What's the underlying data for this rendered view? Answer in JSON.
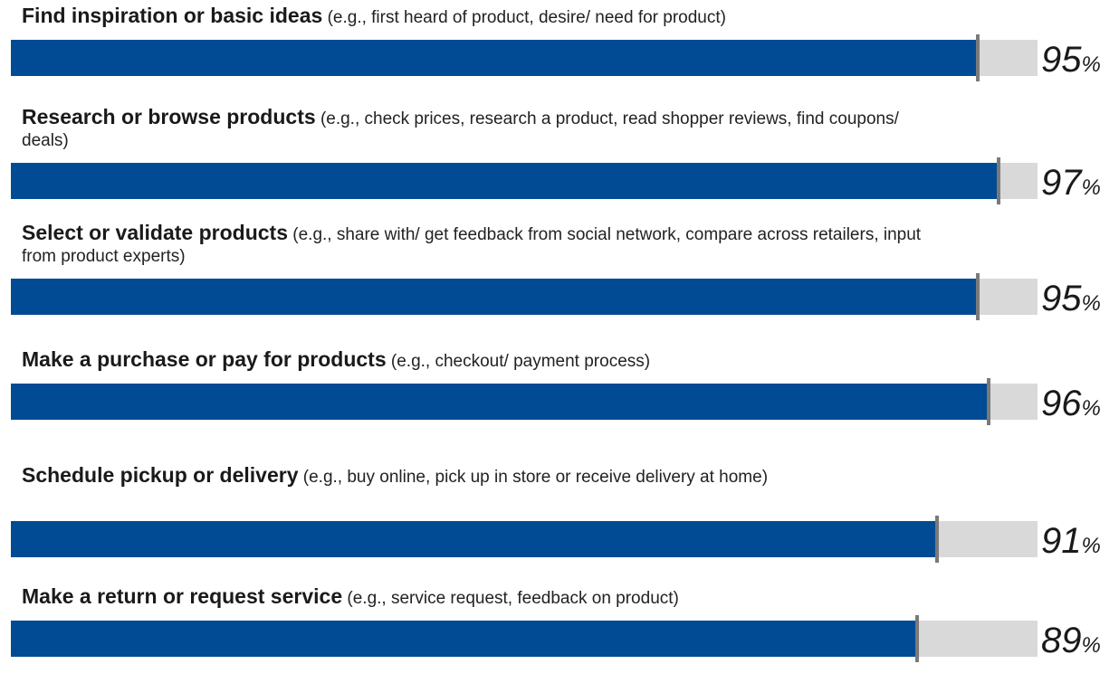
{
  "chart_data": {
    "type": "bar",
    "orientation": "horizontal",
    "xlim": [
      0,
      100
    ],
    "value_suffix": "%",
    "categories": [
      {
        "title": "Find inspiration or basic ideas",
        "note": "(e.g., first heard of product, desire/ need for product)",
        "value": 95
      },
      {
        "title": "Research or browse products",
        "note": "(e.g., check prices, research a product, read shopper reviews, find coupons/ deals)",
        "value": 97
      },
      {
        "title": "Select or validate products",
        "note": "(e.g., share with/ get feedback from social network, compare across retailers, input from product experts)",
        "value": 95
      },
      {
        "title": "Make a purchase or pay for products",
        "note": "(e.g., checkout/ payment process)",
        "value": 96
      },
      {
        "title": "Schedule pickup or delivery",
        "note": "(e.g., buy online, pick up in store or receive delivery at home)",
        "value": 91
      },
      {
        "title": "Make a return or request service",
        "note": "(e.g., service request, feedback on product)",
        "value": 89
      }
    ],
    "colors": {
      "bar": "#004b93",
      "track": "#d9d9d9",
      "marker": "#7a7a7a"
    }
  }
}
